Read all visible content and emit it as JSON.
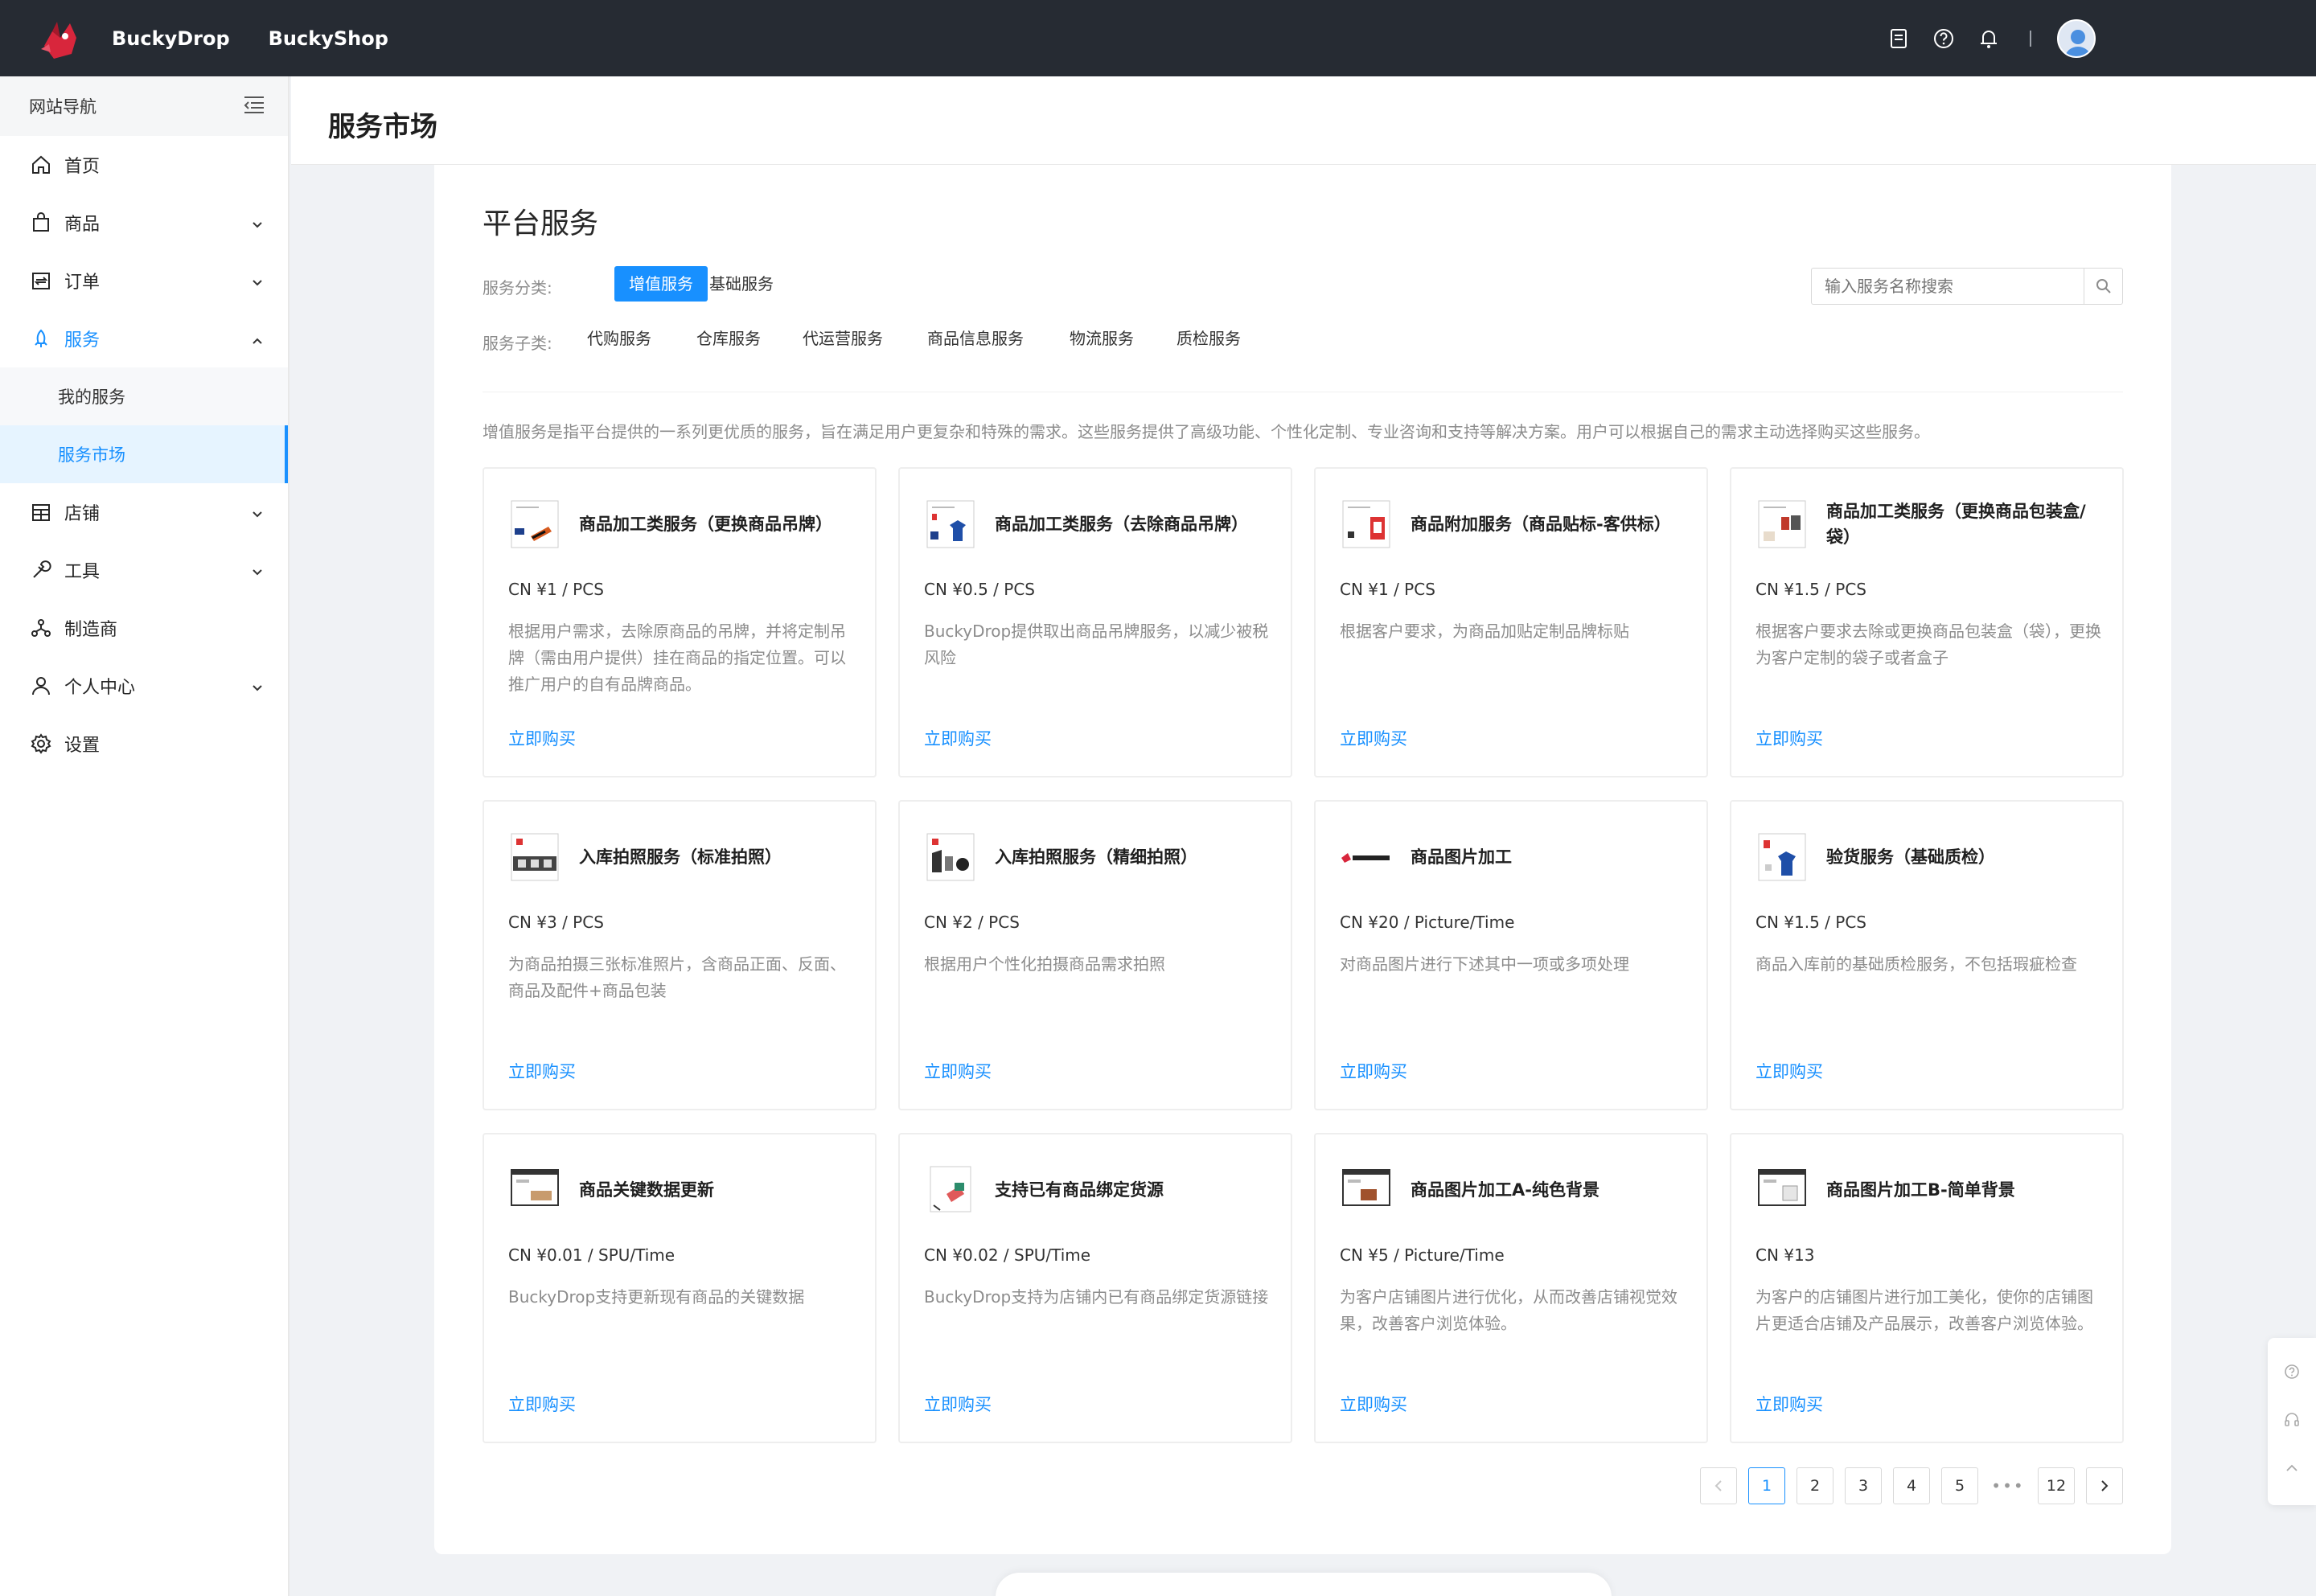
{
  "topbar": {
    "brand": "BuckyDrop",
    "shop": "BuckyShop",
    "icons": [
      "document-icon",
      "help-icon",
      "bell-icon",
      "user-avatar"
    ]
  },
  "sidebar": {
    "header": "网站导航",
    "items": [
      {
        "label": "首页",
        "icon": "home-icon"
      },
      {
        "label": "商品",
        "icon": "bag-icon"
      },
      {
        "label": "订单",
        "icon": "order-icon"
      },
      {
        "label": "服务",
        "icon": "service-icon",
        "active": true
      },
      {
        "label": "我的服务",
        "sub": true
      },
      {
        "label": "服务市场",
        "sub": true,
        "selected": true
      },
      {
        "label": "店铺",
        "icon": "store-icon"
      },
      {
        "label": "工具",
        "icon": "wrench-icon"
      },
      {
        "label": "制造商",
        "icon": "network-icon"
      },
      {
        "label": "个人中心",
        "icon": "user-icon"
      },
      {
        "label": "设置",
        "icon": "gear-icon"
      }
    ]
  },
  "page": {
    "title": "服务市场",
    "section_title": "平台服务",
    "category_label": "服务分类:",
    "categories": [
      "增值服务",
      "基础服务"
    ],
    "subcategory_label": "服务子类:",
    "subcategories": [
      "代购服务",
      "仓库服务",
      "代运营服务",
      "商品信息服务",
      "物流服务",
      "质检服务"
    ],
    "search_placeholder": "输入服务名称搜索",
    "description": "增值服务是指平台提供的一系列更优质的服务，旨在满足用户更复杂和特殊的需求。这些服务提供了高级功能、个性化定制、专业咨询和支持等解决方案。用户可以根据自己的需求主动选择购买这些服务。"
  },
  "cards": [
    {
      "title": "商品加工类服务（更换商品吊牌）",
      "price": "CN ¥1 / PCS",
      "desc": "根据用户需求，去除原商品的吊牌，并将定制吊牌（需由用户提供）挂在商品的指定位置。可以推广用户的自有品牌商品。",
      "buy": "立即购买"
    },
    {
      "title": "商品加工类服务（去除商品吊牌）",
      "price": "CN ¥0.5 / PCS",
      "desc": "BuckyDrop提供取出商品吊牌服务，以减少被税风险",
      "buy": "立即购买"
    },
    {
      "title": "商品附加服务（商品贴标-客供标）",
      "price": "CN ¥1 / PCS",
      "desc": "根据客户要求，为商品加贴定制品牌标贴",
      "buy": "立即购买"
    },
    {
      "title": "商品加工类服务（更换商品包装盒/袋）",
      "price": "CN ¥1.5 / PCS",
      "desc": "根据客户要求去除或更换商品包装盒（袋），更换为客户定制的袋子或者盒子",
      "buy": "立即购买"
    },
    {
      "title": "入库拍照服务（标准拍照）",
      "price": "CN ¥3 / PCS",
      "desc": "为商品拍摄三张标准照片，含商品正面、反面、商品及配件+商品包装",
      "buy": "立即购买"
    },
    {
      "title": "入库拍照服务（精细拍照）",
      "price": "CN ¥2 / PCS",
      "desc": "根据用户个性化拍摄商品需求拍照",
      "buy": "立即购买"
    },
    {
      "title": "商品图片加工",
      "price": "CN ¥20 / Picture/Time",
      "desc": "对商品图片进行下述其中一项或多项处理",
      "buy": "立即购买"
    },
    {
      "title": "验货服务（基础质检）",
      "price": "CN ¥1.5 / PCS",
      "desc": "商品入库前的基础质检服务，不包括瑕疵检查",
      "buy": "立即购买"
    },
    {
      "title": "商品关键数据更新",
      "price": "CN ¥0.01 / SPU/Time",
      "desc": "BuckyDrop支持更新现有商品的关键数据",
      "buy": "立即购买"
    },
    {
      "title": "支持已有商品绑定货源",
      "price": "CN ¥0.02 / SPU/Time",
      "desc": "BuckyDrop支持为店铺内已有商品绑定货源链接",
      "buy": "立即购买"
    },
    {
      "title": "商品图片加工A-纯色背景",
      "price": "CN ¥5 / Picture/Time",
      "desc": "为客户店铺图片进行优化，从而改善店铺视觉效果，改善客户浏览体验。",
      "buy": "立即购买"
    },
    {
      "title": "商品图片加工B-简单背景",
      "price": "CN ¥13",
      "desc": "为客户的店铺图片进行加工美化，使你的店铺图片更适合店铺及产品展示，改善客户浏览体验。",
      "buy": "立即购买"
    }
  ],
  "pagination": {
    "pages": [
      "1",
      "2",
      "3",
      "4",
      "5"
    ],
    "ellipsis": "•••",
    "last": "12",
    "current": "1"
  },
  "colors": {
    "accent": "#1890ff",
    "topbar": "#262b33"
  }
}
